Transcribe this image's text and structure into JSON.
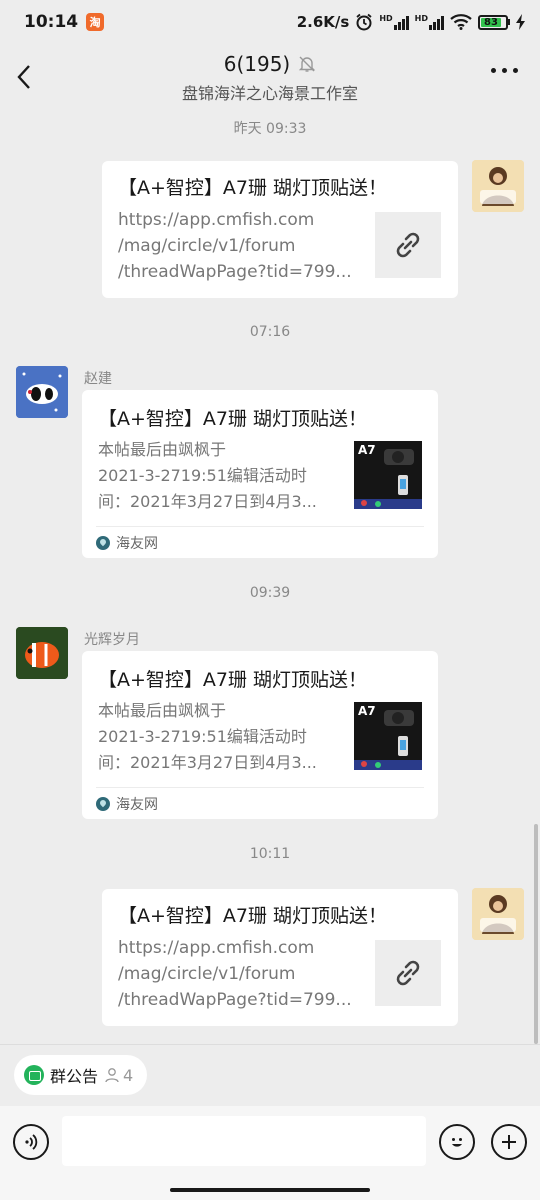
{
  "status_bar": {
    "time": "10:14",
    "app_icon": "taobao-icon",
    "net_speed": "2.6K/s",
    "hd1": "HD",
    "hd2": "HD",
    "battery": "83",
    "battery_color": "#32c24d"
  },
  "header": {
    "title": "6(195)",
    "subtitle": "盘锦海洋之心海景工作室",
    "mute_icon": "bell-muted-icon",
    "back_icon": "back-arrow-icon",
    "more_icon": "more-dots-icon"
  },
  "messages": [
    {
      "time": "昨天 09:33",
      "side": "right",
      "title": "【A+智控】A7珊 瑚灯顶贴送！",
      "lines": [
        "https://app.cmfish.com",
        "/mag/circle/v1/forum",
        "/threadWapPage?tid=799..."
      ]
    },
    {
      "time": "07:16",
      "side": "left",
      "sender": "赵建",
      "title": "【A+智控】A7珊 瑚灯顶贴送！",
      "lines": [
        "本帖最后由飒枫于",
        "2021-3-2719:51编辑活动时",
        "间：2021年3月27日到4月3..."
      ],
      "thumb_label": "A7",
      "source": "海友网"
    },
    {
      "time": "09:39",
      "side": "left",
      "sender": "光辉岁月",
      "title": "【A+智控】A7珊 瑚灯顶贴送！",
      "lines": [
        "本帖最后由飒枫于",
        "2021-3-2719:51编辑活动时",
        "间：2021年3月27日到4月3..."
      ],
      "thumb_label": "A7",
      "source": "海友网"
    },
    {
      "time": "10:11",
      "side": "right",
      "title": "【A+智控】A7珊 瑚灯顶贴送！",
      "lines": [
        "https://app.cmfish.com",
        "/mag/circle/v1/forum",
        "/threadWapPage?tid=799..."
      ]
    }
  ],
  "bottom": {
    "notice_label": "群公告",
    "member_count": "4",
    "voice_icon": "voice-icon",
    "emoji_icon": "emoji-icon",
    "plus_icon": "plus-icon"
  }
}
